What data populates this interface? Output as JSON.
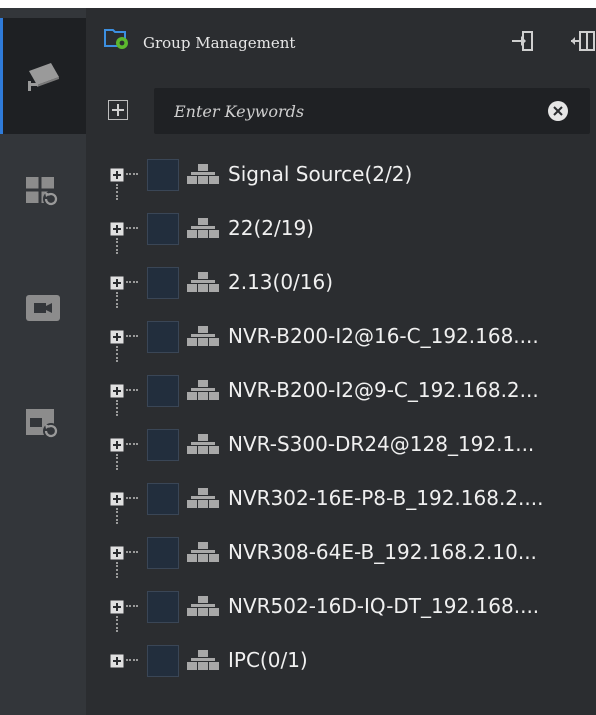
{
  "rail": {
    "items": [
      {
        "icon": "camera-icon",
        "active": true
      },
      {
        "icon": "playback-grid-icon",
        "active": false
      },
      {
        "icon": "video-camera-icon",
        "active": false
      },
      {
        "icon": "playback-window-icon",
        "active": false
      }
    ]
  },
  "header": {
    "title": "Group Management",
    "title_icon": "folder-settings-icon",
    "actions": [
      "import-icon",
      "export-icon"
    ]
  },
  "search": {
    "add_icon": "add-icon",
    "placeholder": "Enter Keywords",
    "clear_icon": "clear-icon"
  },
  "tree": {
    "items": [
      "Signal Source(2/2)",
      "22(2/19)",
      "2.13(0/16)",
      "NVR-B200-I2@16-C_192.168....",
      "NVR-B200-I2@9-C_192.168.2...",
      "NVR-S300-DR24@128_192.1...",
      "NVR302-16E-P8-B_192.168.2....",
      "NVR308-64E-B_192.168.2.10...",
      "NVR502-16D-IQ-DT_192.168....",
      "IPC(0/1)"
    ]
  },
  "colors": {
    "panel": "#2b2d30",
    "rail": "#33363a",
    "accent": "#2f7bd9",
    "checkbox": "#222e3d"
  }
}
